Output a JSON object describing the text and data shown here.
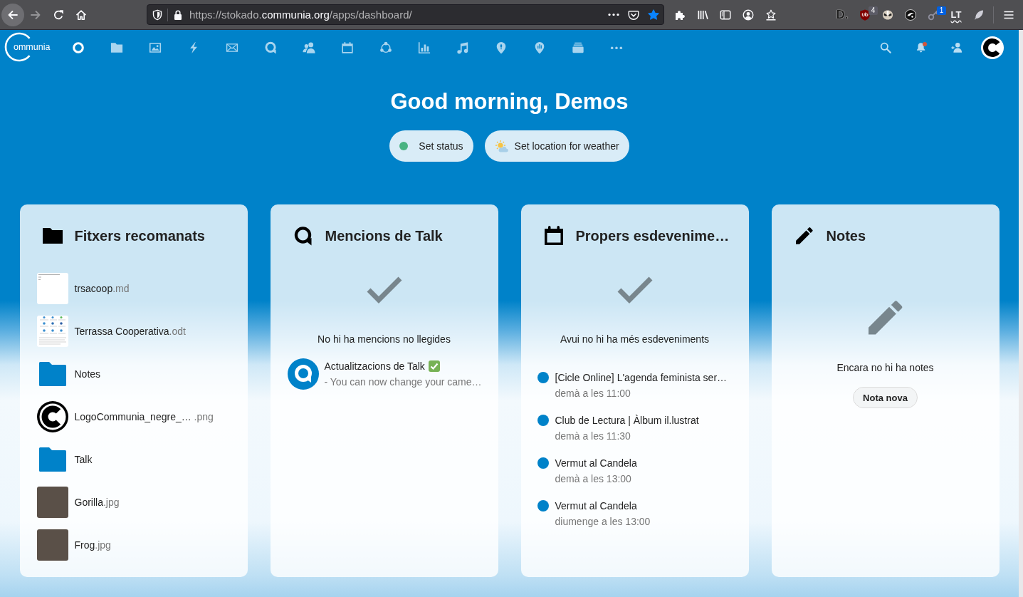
{
  "browser": {
    "nav_buttons": [
      {
        "kind": "back",
        "disabled": false
      },
      {
        "kind": "forward",
        "disabled": true
      },
      {
        "kind": "reload",
        "disabled": false
      },
      {
        "kind": "home",
        "disabled": false
      }
    ],
    "url": {
      "start": "https://stokado.",
      "domain": "communia.org",
      "end": "/apps/dashboard/"
    },
    "bookmarked": true,
    "toolbar": [
      {
        "kind": "puzzle"
      },
      {
        "kind": "library"
      },
      {
        "kind": "sidebar"
      },
      {
        "kind": "account"
      },
      {
        "kind": "startray"
      }
    ],
    "extensions": [
      {
        "kind": "lettermark",
        "label": "D."
      },
      {
        "kind": "shield",
        "badge": "4",
        "color": "#5b5b66"
      },
      {
        "kind": "badger"
      },
      {
        "kind": "emblem"
      },
      {
        "kind": "key",
        "badge": "1",
        "color": "#0060df"
      },
      {
        "kind": "wordmark",
        "label": "LT"
      },
      {
        "kind": "feather"
      }
    ]
  },
  "header": {
    "logo_text": "ommunia",
    "apps": [
      {
        "kind": "ring",
        "selected": true
      },
      {
        "kind": "folder",
        "selected": false
      },
      {
        "kind": "image",
        "selected": false
      },
      {
        "kind": "bolt",
        "selected": false
      },
      {
        "kind": "envelope",
        "selected": false
      },
      {
        "kind": "bubble",
        "selected": false
      },
      {
        "kind": "people",
        "selected": false
      },
      {
        "kind": "calendar",
        "selected": false
      },
      {
        "kind": "nodes",
        "selected": false
      },
      {
        "kind": "bars",
        "selected": false
      },
      {
        "kind": "note",
        "selected": false
      },
      {
        "kind": "pin",
        "selected": false
      },
      {
        "kind": "beacon",
        "selected": false
      },
      {
        "kind": "stack",
        "selected": false
      },
      {
        "kind": "dots",
        "selected": false
      }
    ],
    "actions": [
      {
        "kind": "search",
        "dot": false
      },
      {
        "kind": "bell",
        "dot": true
      },
      {
        "kind": "person",
        "dot": false
      }
    ]
  },
  "greeting": "Good morning, Demos",
  "status_buttons": [
    {
      "kind": "status",
      "label": "Set status",
      "color": "#49b382"
    },
    {
      "kind": "weather",
      "label": "Set location for weather"
    }
  ],
  "widgets": [
    {
      "kind": "files",
      "title": "Fitxers recomanats",
      "items": [
        {
          "kind": "textfile",
          "name": "trsacoop",
          "extension": ".md"
        },
        {
          "kind": "document",
          "name": "Terrassa Cooperativa",
          "extension": ".odt"
        },
        {
          "kind": "folder",
          "name": "Notes"
        },
        {
          "kind": "logo",
          "name": "LogoCommunia_negre_…",
          "extension": " .png"
        },
        {
          "kind": "folder",
          "name": "Talk"
        },
        {
          "kind": "photo",
          "name": "Gorilla",
          "extension": ".jpg"
        },
        {
          "kind": "photo",
          "name": "Frog",
          "extension": ".jpg"
        }
      ]
    },
    {
      "kind": "talk",
      "title": "Mencions de Talk",
      "empty_message": "No hi ha mencions no llegides",
      "items": [
        {
          "title": "Actualitzacions de Talk",
          "subtitle": "- You can now change your came…"
        }
      ]
    },
    {
      "kind": "calendar",
      "title": "Propers esdevenime…",
      "empty_message": "Avui no hi ha més esdeveniments",
      "items": [
        {
          "title": "[Cicle Online] L'agenda feminista ser…",
          "time": "demà a les 11:00",
          "color": "#0082c9"
        },
        {
          "title": "Club de Lectura | Àlbum il.lustrat",
          "time": "demà a les 11:30",
          "color": "#0082c9"
        },
        {
          "title": "Vermut al Candela",
          "time": "demà a les 13:00",
          "color": "#0082c9"
        },
        {
          "title": "Vermut al Candela",
          "time": "diumenge a les 13:00",
          "color": "#0082c9"
        }
      ]
    },
    {
      "kind": "notes",
      "title": "Notes",
      "empty_message": "Encara no hi ha notes",
      "button": "Nota nova"
    }
  ]
}
